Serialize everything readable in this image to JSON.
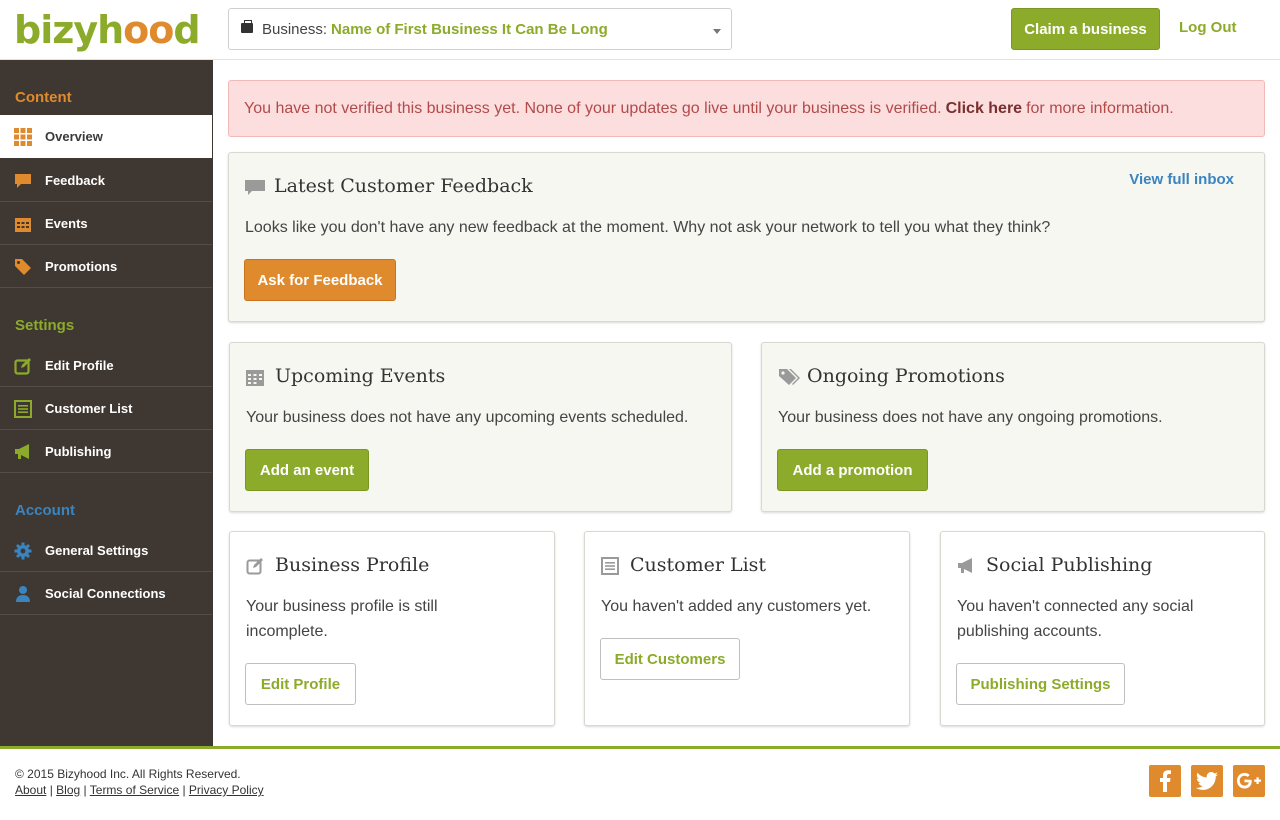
{
  "header": {
    "logo": "bizyhood",
    "business_prefix": "Business:",
    "business_name": "Name of First Business It Can Be Long",
    "claim_label": "Claim a business",
    "logout_label": "Log Out"
  },
  "sidebar": {
    "sections": {
      "content": "Content",
      "settings": "Settings",
      "account": "Account"
    },
    "items": [
      {
        "label": "Overview",
        "icon": "grid-icon"
      },
      {
        "label": "Feedback",
        "icon": "speech-bubble-icon"
      },
      {
        "label": "Events",
        "icon": "calendar-icon"
      },
      {
        "label": "Promotions",
        "icon": "tags-icon"
      },
      {
        "label": "Edit Profile",
        "icon": "edit-icon"
      },
      {
        "label": "Customer List",
        "icon": "list-icon"
      },
      {
        "label": "Publishing",
        "icon": "megaphone-icon"
      },
      {
        "label": "General Settings",
        "icon": "gear-icon"
      },
      {
        "label": "Social Connections",
        "icon": "user-icon"
      }
    ]
  },
  "alert": {
    "text": "You have not verified this business yet. None of your updates go live until your business is verified.",
    "link": "Click here",
    "suffix": "for more information."
  },
  "feedback_card": {
    "title": "Latest Customer Feedback",
    "inbox_link": "View full inbox",
    "text": "Looks like you don't have any new feedback at the moment. Why not ask your network to tell you what they think?",
    "button": "Ask for Feedback"
  },
  "events_card": {
    "title": "Upcoming Events",
    "text": "Your business does not have any upcoming events scheduled.",
    "button": "Add an event"
  },
  "promotions_card": {
    "title": "Ongoing Promotions",
    "text": "Your business does not have any ongoing promotions.",
    "button": "Add a promotion"
  },
  "profile_card": {
    "title": "Business Profile",
    "text": "Your business profile is still incomplete.",
    "button": "Edit Profile"
  },
  "customers_card": {
    "title": "Customer List",
    "text": "You haven't added any customers yet.",
    "button": "Edit Customers"
  },
  "publishing_card": {
    "title": "Social Publishing",
    "text": "You haven't connected any social publishing accounts.",
    "button": "Publishing Settings"
  },
  "footer": {
    "copyright": "© 2015 Bizyhood Inc. All Rights Reserved.",
    "links": [
      "About",
      "Blog",
      "Terms of Service",
      "Privacy Policy"
    ]
  },
  "colors": {
    "brand_green": "#8cab2a",
    "brand_orange": "#e08a2e",
    "sidebar_bg": "#3f3731",
    "alert_bg": "#fcdede",
    "link_blue": "#3a84c0"
  }
}
